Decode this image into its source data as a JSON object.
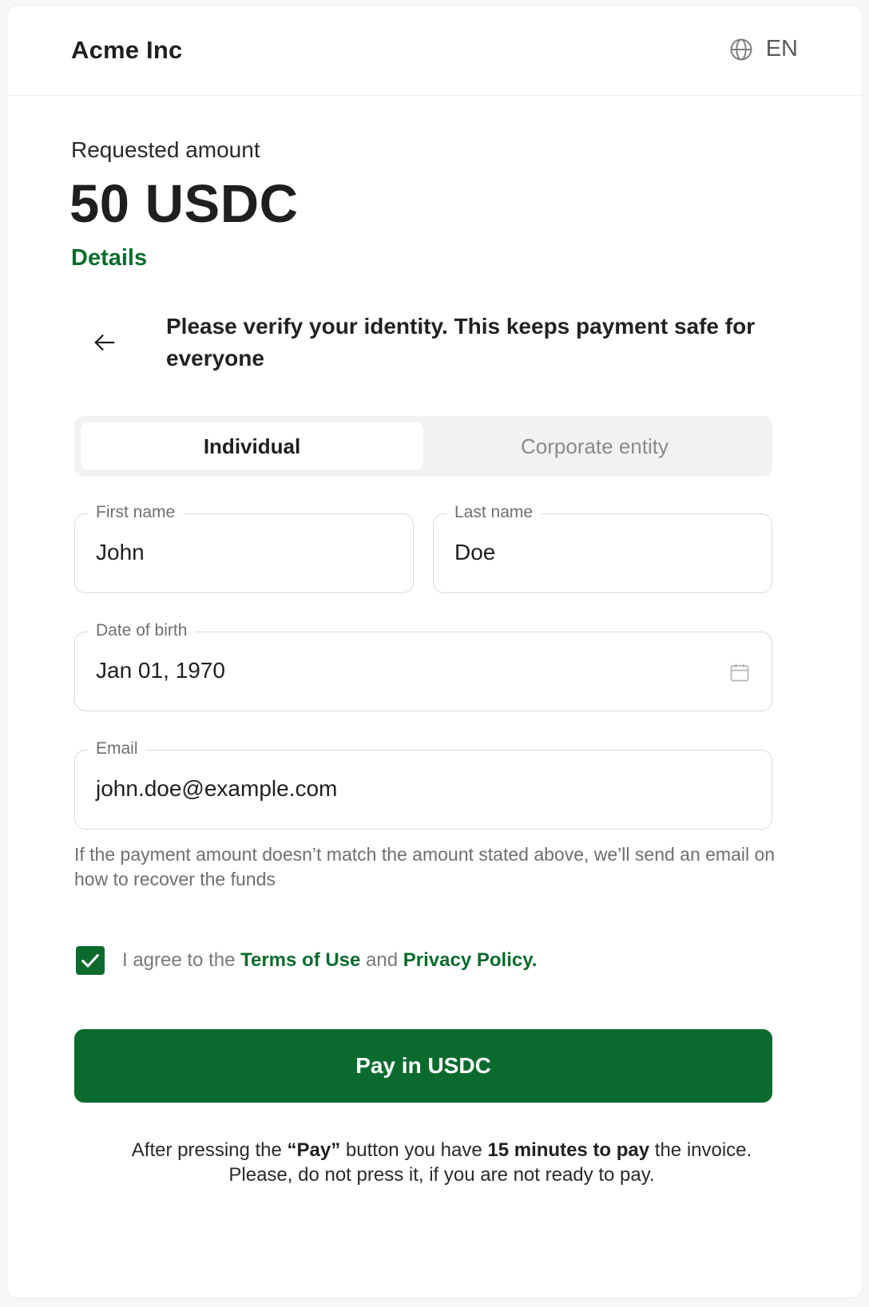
{
  "header": {
    "brand": "Acme Inc",
    "language": "EN",
    "language_icon": "globe-icon"
  },
  "payment": {
    "requested_label": "Requested amount",
    "amount": "50 USDC",
    "details_link": "Details"
  },
  "verify": {
    "back_icon": "arrow-left-icon",
    "message": "Please verify your identity. This keeps payment safe for everyone"
  },
  "tabs": [
    {
      "label": "Individual",
      "active": true
    },
    {
      "label": "Corporate entity",
      "active": false
    }
  ],
  "form": {
    "first_name": {
      "label": "First name",
      "value": "John"
    },
    "last_name": {
      "label": "Last name",
      "value": "Doe"
    },
    "dob": {
      "label": "Date of birth",
      "value": "Jan 01, 1970",
      "icon": "calendar-icon"
    },
    "email": {
      "label": "Email",
      "value": "john.doe@example.com"
    },
    "hint": "If the payment amount doesn’t match the amount stated above, we’ll send an email on how to recover the funds"
  },
  "agreement": {
    "checked": true,
    "prefix": "I agree to the ",
    "terms": "Terms of Use",
    "middle": " and ",
    "privacy": "Privacy Policy."
  },
  "pay_button": "Pay in USDC",
  "footer": {
    "line1_a": "After pressing the ",
    "line1_b": "“Pay”",
    "line1_c": " button you have ",
    "line1_d": "15 minutes to pay",
    "line1_e": " the invoice.",
    "line2": "Please, do not press it, if you are not ready to pay."
  },
  "colors": {
    "brand_green": "#0b6b2e",
    "border": "#d9d9d9",
    "muted_text": "#6f6f6f"
  }
}
